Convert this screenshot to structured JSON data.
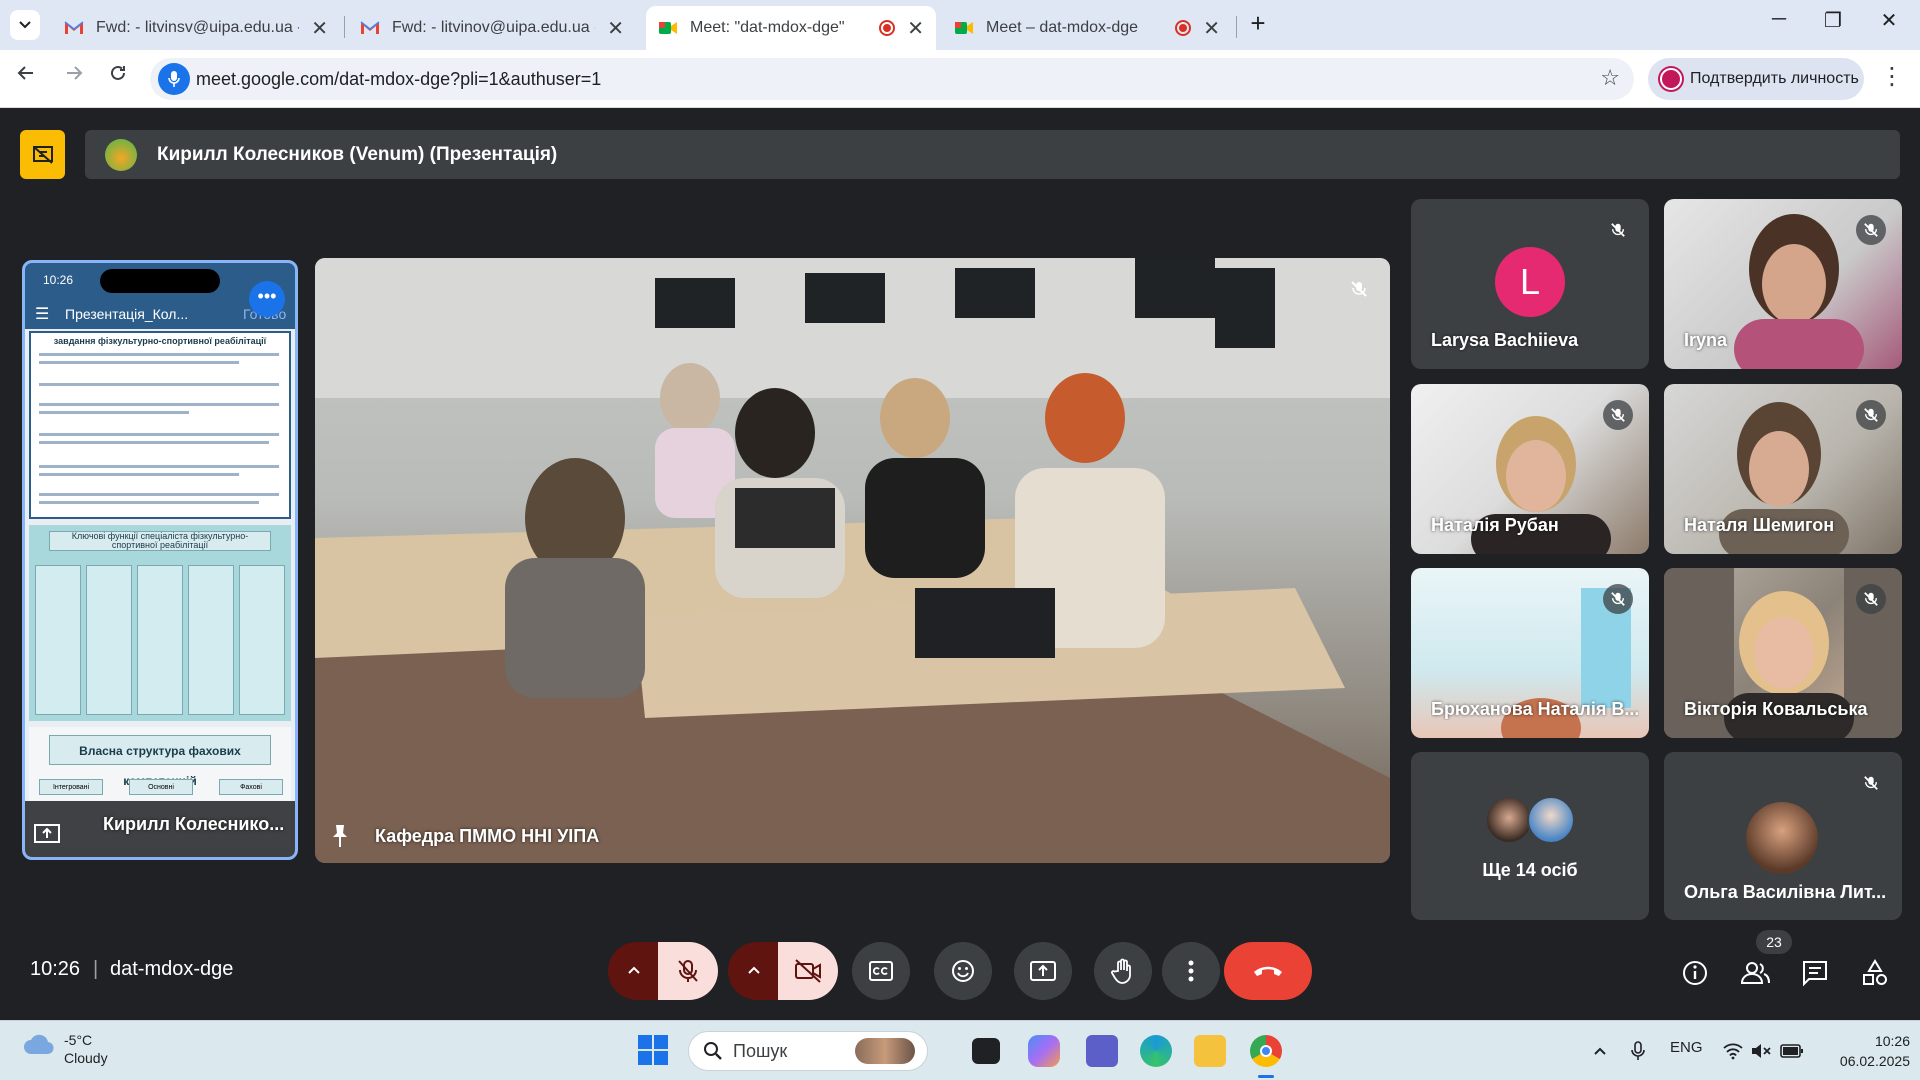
{
  "browser": {
    "tabs": [
      {
        "title": "Fwd: - litvinsv@uipa.edu.ua - пс",
        "type": "gmail"
      },
      {
        "title": "Fwd: - litvinov@uipa.edu.ua - П",
        "type": "gmail"
      },
      {
        "title": "Meet: \"dat-mdox-dge\"",
        "type": "meet",
        "active": true,
        "recording": true
      },
      {
        "title": "Meet – dat-mdox-dge",
        "type": "meet",
        "recording": true
      }
    ],
    "new_tab": "+",
    "url": "meet.google.com/dat-mdox-dge?pli=1&authuser=1",
    "verify_label": "Подтвердить личность"
  },
  "meet": {
    "presenter_label": "Кирилл Колесников (Venum) (Презентація)",
    "presentation": {
      "phone_time": "10:26",
      "doc_title": "Презентація_Кол...",
      "done_label": "Готово",
      "slide1_heading": "завдання фізкультурно-спортивної реабілітації",
      "slide2_heading": "Ключові функції спеціаліста фізкультурно-спортивної реабілітації",
      "slide3_heading": "Власна структура фахових компетенцій",
      "slide3_cols": [
        "Інтегровані",
        "Основні",
        "Фахові (спеціальні)"
      ],
      "presenter_name": "Кирилл Колеснико..."
    },
    "main_tile_name": "Кафедра ПММО ННІ УІПА",
    "participants": [
      {
        "name": "Larysa Bachiieva",
        "initial": "L",
        "muted": true
      },
      {
        "name": "Iryna",
        "muted": true
      },
      {
        "name": "Наталія Рубан",
        "muted": true
      },
      {
        "name": "Наталя Шемигон",
        "muted": true
      },
      {
        "name": "Брюханова Наталія В...",
        "muted": true
      },
      {
        "name": "Вікторія Ковальська",
        "muted": true
      },
      {
        "name": "Ольга Василівна Лит...",
        "muted": true
      }
    ],
    "more_label": "Ще 14 осіб",
    "meeting_time": "10:26",
    "meeting_code": "dat-mdox-dge",
    "people_count": "23"
  },
  "taskbar": {
    "temperature": "-5°C",
    "condition": "Cloudy",
    "search_placeholder": "Пошук",
    "language": "ENG",
    "time": "10:26",
    "date": "06.02.2025"
  },
  "colors": {
    "accent": "#1a73e8",
    "end_call": "#ea4335",
    "presenting": "#fbbc04",
    "larysa_avatar": "#e52a72"
  }
}
